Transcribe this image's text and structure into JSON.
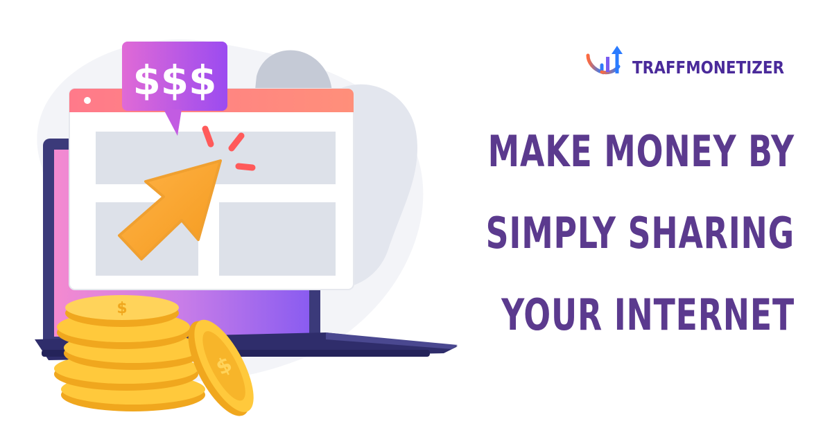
{
  "brand": {
    "name": "TRAFFMONETIZER",
    "logo_icon": "chart-arrow-logo-icon",
    "colors": {
      "gradient_start": "#ff6a3d",
      "gradient_end": "#2a7bff",
      "text": "#4a2a9a"
    }
  },
  "headline": {
    "lines": [
      "MAKE MONEY BY",
      "SIMPLY SHARING",
      "YOUR INTERNET"
    ],
    "color": "#5b3a8e"
  },
  "illustration": {
    "bubble_text": "$$$",
    "icons": [
      "laptop-icon",
      "browser-window-icon",
      "cursor-arrow-icon",
      "coin-stack-icon",
      "coin-icon"
    ]
  }
}
